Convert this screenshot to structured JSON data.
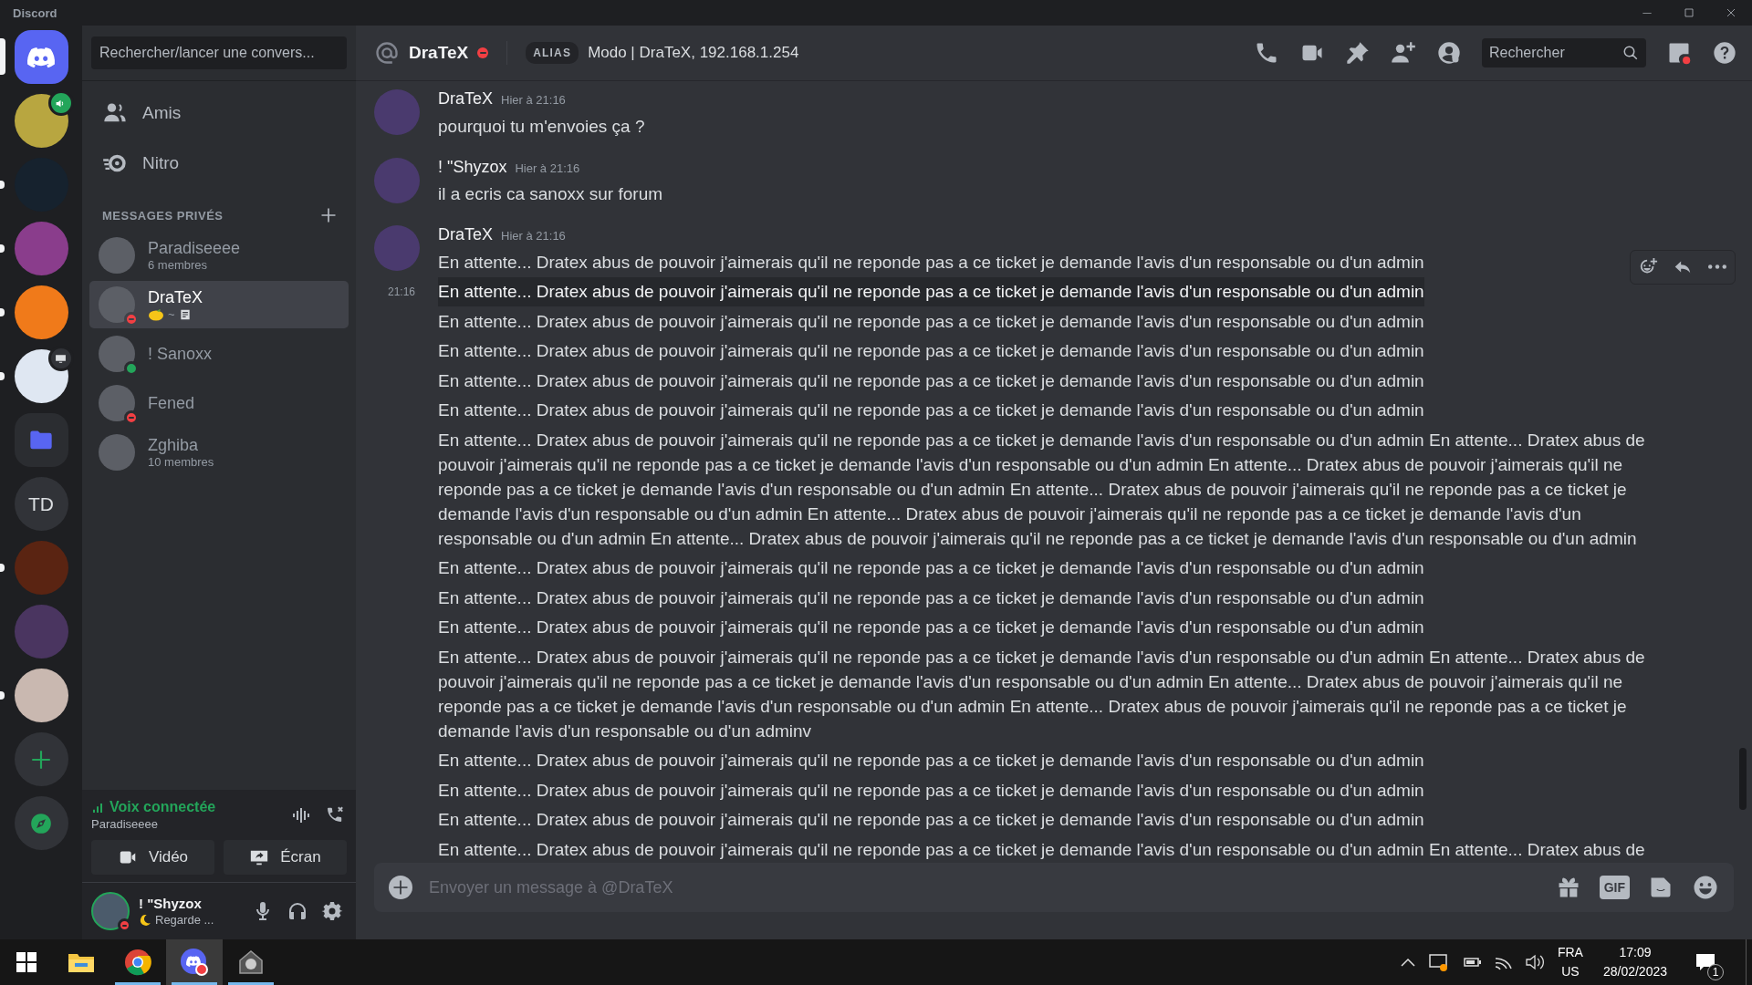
{
  "titlebar": {
    "title": "Discord"
  },
  "rail": {
    "items": [
      {
        "kind": "home",
        "selected": true,
        "unread": false
      },
      {
        "kind": "image",
        "color": "#b8a640",
        "badge": {
          "kind": "voice"
        },
        "selected": false,
        "unread": false
      },
      {
        "kind": "image",
        "color": "#16222e",
        "selected": false,
        "unread": true
      },
      {
        "kind": "image",
        "color": "#8a3d8c",
        "selected": false,
        "unread": true
      },
      {
        "kind": "image",
        "color": "#f07a1a",
        "selected": false,
        "unread": true
      },
      {
        "kind": "image",
        "color": "#dfe7f2",
        "badge": {
          "kind": "screen"
        },
        "selected": false,
        "unread": true
      },
      {
        "kind": "folder",
        "selected": false,
        "unread": false
      },
      {
        "kind": "text",
        "label": "TD",
        "selected": false,
        "unread": false
      },
      {
        "kind": "image",
        "color": "#5a2412",
        "selected": false,
        "unread": true
      },
      {
        "kind": "image",
        "color": "#4a3560",
        "selected": false,
        "unread": false
      },
      {
        "kind": "image",
        "color": "#c9b8b0",
        "selected": false,
        "unread": true
      },
      {
        "kind": "add",
        "selected": false,
        "unread": false
      },
      {
        "kind": "explore",
        "selected": false,
        "unread": false
      }
    ]
  },
  "sidebar": {
    "search": "Rechercher/lancer une convers...",
    "nav": [
      {
        "kind": "friends",
        "label": "Amis"
      },
      {
        "kind": "nitro",
        "label": "Nitro"
      }
    ],
    "dm_header": "MESSAGES PRIVÉS",
    "dms": [
      {
        "name": "Paradiseeee",
        "subtitle": "6 membres",
        "selected": false
      },
      {
        "name": "DraTeX",
        "status_dot": {
          "kind": "dnd",
          "color": "#f23f43"
        },
        "activity": "~",
        "selected": true
      },
      {
        "name": "! Sanoxx",
        "status_dot": {
          "kind": "online",
          "color": "#23a55a"
        },
        "selected": false
      },
      {
        "name": "Fened",
        "status_dot": {
          "kind": "dnd",
          "color": "#f23f43"
        },
        "selected": false
      },
      {
        "name": "Zghiba",
        "subtitle": "10 membres",
        "selected": false
      }
    ],
    "voice": {
      "status": "Voix connectée",
      "channel": "Paradiseeee",
      "buttons": [
        {
          "kind": "video",
          "label": "Vidéo"
        },
        {
          "kind": "screen",
          "label": "Écran"
        }
      ]
    },
    "user": {
      "name": "! \"Shyzox",
      "status_dot": {
        "kind": "dnd",
        "color": "#f23f43"
      },
      "activity": "Regarde ..."
    }
  },
  "chat": {
    "header": {
      "name": "DraTeX",
      "status_dot": {
        "kind": "dnd",
        "color": "#f23f43"
      },
      "alias_tag": "ALIAS",
      "alias": "Modo | DraTeX, 192.168.1.254",
      "search_placeholder": "Rechercher"
    },
    "groups": [
      {
        "author": "DraTeX",
        "time": "Hier à 21:16",
        "lines": [
          {
            "text": "pourquoi tu m'envoies ça ?",
            "hovered": false
          }
        ]
      },
      {
        "author": "! \"Shyzox",
        "time": "Hier à 21:16",
        "lines": [
          {
            "text": "il a ecris ca sanoxx sur forum",
            "hovered": false
          }
        ]
      },
      {
        "author": "DraTeX",
        "time": "Hier à 21:16",
        "lines": [
          {
            "text": "En attente... Dratex abus de pouvoir j'aimerais qu'il ne reponde pas a ce ticket je demande l'avis d'un responsable ou d'un admin",
            "hovered": false
          },
          {
            "text": "En attente... Dratex abus de pouvoir j'aimerais qu'il ne reponde pas a ce ticket je demande l'avis d'un responsable ou d'un admin",
            "hovered": true,
            "time": "21:16"
          },
          {
            "text": "En attente... Dratex abus de pouvoir j'aimerais qu'il ne reponde pas a ce ticket je demande l'avis d'un responsable ou d'un admin",
            "hovered": false
          },
          {
            "text": "En attente... Dratex abus de pouvoir j'aimerais qu'il ne reponde pas a ce ticket je demande l'avis d'un responsable ou d'un admin",
            "hovered": false
          },
          {
            "text": "En attente... Dratex abus de pouvoir j'aimerais qu'il ne reponde pas a ce ticket je demande l'avis d'un responsable ou d'un admin",
            "hovered": false
          },
          {
            "text": "En attente... Dratex abus de pouvoir j'aimerais qu'il ne reponde pas a ce ticket je demande l'avis d'un responsable ou d'un admin",
            "hovered": false
          },
          {
            "text": "En attente... Dratex abus de pouvoir j'aimerais qu'il ne reponde pas a ce ticket je demande l'avis d'un responsable ou d'un admin En attente... Dratex abus de pouvoir j'aimerais qu'il ne reponde pas a ce ticket je demande l'avis d'un responsable ou d'un admin En attente... Dratex abus de pouvoir j'aimerais qu'il ne reponde pas a ce ticket je demande l'avis d'un responsable ou d'un admin En attente... Dratex abus de pouvoir j'aimerais qu'il ne reponde pas a ce ticket je demande l'avis d'un responsable ou d'un admin En attente... Dratex abus de pouvoir j'aimerais qu'il ne reponde pas a ce ticket je demande l'avis d'un responsable ou d'un admin En attente... Dratex abus de pouvoir j'aimerais qu'il ne reponde pas a ce ticket je demande l'avis d'un responsable ou d'un admin",
            "hovered": false
          },
          {
            "text": "En attente... Dratex abus de pouvoir j'aimerais qu'il ne reponde pas a ce ticket je demande l'avis d'un responsable ou d'un admin",
            "hovered": false
          },
          {
            "text": "En attente... Dratex abus de pouvoir j'aimerais qu'il ne reponde pas a ce ticket je demande l'avis d'un responsable ou d'un admin",
            "hovered": false
          },
          {
            "text": "En attente... Dratex abus de pouvoir j'aimerais qu'il ne reponde pas a ce ticket je demande l'avis d'un responsable ou d'un admin",
            "hovered": false
          },
          {
            "text": "En attente... Dratex abus de pouvoir j'aimerais qu'il ne reponde pas a ce ticket je demande l'avis d'un responsable ou d'un admin En attente... Dratex abus de pouvoir j'aimerais qu'il ne reponde pas a ce ticket je demande l'avis d'un responsable ou d'un admin En attente... Dratex abus de pouvoir j'aimerais qu'il ne reponde pas a ce ticket je demande l'avis d'un responsable ou d'un admin En attente... Dratex abus de pouvoir j'aimerais qu'il ne reponde pas a ce ticket je demande l'avis d'un responsable ou d'un adminv",
            "hovered": false
          },
          {
            "text": "En attente... Dratex abus de pouvoir j'aimerais qu'il ne reponde pas a ce ticket je demande l'avis d'un responsable ou d'un admin",
            "hovered": false
          },
          {
            "text": "En attente... Dratex abus de pouvoir j'aimerais qu'il ne reponde pas a ce ticket je demande l'avis d'un responsable ou d'un admin",
            "hovered": false
          },
          {
            "text": "En attente... Dratex abus de pouvoir j'aimerais qu'il ne reponde pas a ce ticket je demande l'avis d'un responsable ou d'un admin",
            "hovered": false
          },
          {
            "text": "En attente... Dratex abus de pouvoir j'aimerais qu'il ne reponde pas a ce ticket je demande l'avis d'un responsable ou d'un admin En attente... Dratex abus de",
            "hovered": false
          }
        ]
      }
    ],
    "composer": {
      "placeholder": "Envoyer un message à @DraTeX",
      "gif_label": "GIF"
    }
  },
  "taskbar": {
    "apps": [
      {
        "kind": "explorer",
        "running": false,
        "selected": false
      },
      {
        "kind": "chrome",
        "running": true,
        "selected": false
      },
      {
        "kind": "discord",
        "running": true,
        "selected": true
      },
      {
        "kind": "app",
        "running": true,
        "selected": false
      }
    ],
    "tray": {
      "language": "FRA",
      "layout": "US",
      "time": "17:09",
      "date": "28/02/2023",
      "notifications": "1"
    }
  }
}
